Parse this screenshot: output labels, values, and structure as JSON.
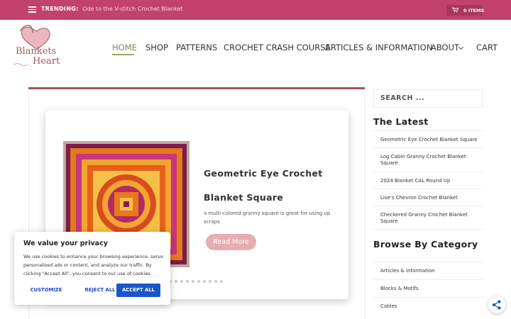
{
  "topbar": {
    "trending_label": "TRENDING:",
    "trending_link": "Ode to the V-stitch Crochet Blanket",
    "cart_label": "0 ITEMS",
    "bg_color": "#c2426e"
  },
  "logo": {
    "line1": "Blankets",
    "line2": "Heart"
  },
  "nav": {
    "items": [
      "HOME",
      "SHOP",
      "PATTERNS",
      "CROCHET CRASH COURSE",
      "ARTICLES & INFORMATION",
      "ABOUT",
      "CART"
    ],
    "active": "HOME"
  },
  "featured": {
    "title_line1": "Geometric Eye Crochet",
    "title_line2": "Blanket Square",
    "description": "a multi-colored granny square is great for using up scraps",
    "button": "Read More",
    "slide_count": 13
  },
  "sidebar": {
    "search_placeholder": "SEARCH ...",
    "latest_heading": "The Latest",
    "latest": [
      "Geometric Eye Crochet Blanket Square",
      "Log Cabin Granny Crochet Blanket Square",
      "2024 Blanket CAL Round Up",
      "Lise's Chevron Crochet Blanket",
      "Checkered Granny Crochet Blanket Square"
    ],
    "category_heading": "Browse By Category",
    "categories": [
      "Articles & Information",
      "Blocks & Motifs",
      "Cables"
    ]
  },
  "cookie": {
    "title": "We value your privacy",
    "text": "We use cookies to enhance your browsing experience, serve personalized ads or content, and analyze our traffic. By clicking \"Accept All\", you consent to our use of cookies.",
    "customize": "CUSTOMIZE",
    "reject": "REJECT ALL",
    "accept": "ACCEPT ALL",
    "accept_color": "#1a55c9"
  },
  "icons": {
    "menu": "hamburger-icon",
    "cart": "cart-icon",
    "chevron": "chevron-down-icon",
    "share": "share-icon"
  }
}
